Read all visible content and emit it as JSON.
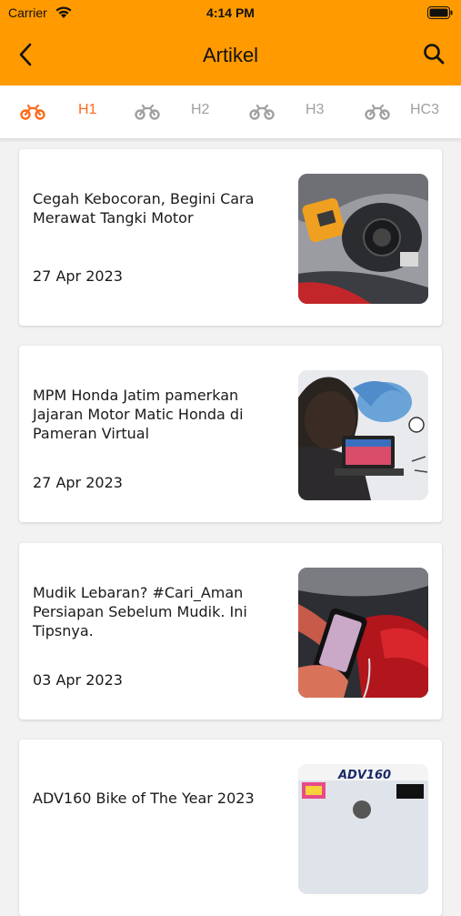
{
  "status_bar": {
    "carrier": "Carrier",
    "time": "4:14 PM"
  },
  "nav": {
    "title": "Artikel",
    "back_icon": "chevron-left-icon",
    "search_icon": "search-icon"
  },
  "tabs": [
    {
      "label": "H1",
      "active": true
    },
    {
      "label": "H2",
      "active": false
    },
    {
      "label": "H3",
      "active": false
    },
    {
      "label": "HC3",
      "active": false
    }
  ],
  "articles": [
    {
      "title": "Cegah Kebocoran, Begini Cara Merawat Tangki Motor",
      "date": "27 Apr 2023"
    },
    {
      "title": "MPM Honda Jatim pamerkan Jajaran Motor Matic Honda di Pameran Virtual",
      "date": "27 Apr 2023"
    },
    {
      "title": "Mudik Lebaran? #Cari_Aman Persiapan Sebelum Mudik. Ini Tipsnya.",
      "date": "03 Apr 2023"
    },
    {
      "title": "ADV160 Bike of The Year 2023",
      "date": "",
      "thumb_text": "ADV160"
    }
  ],
  "colors": {
    "header": "#ff9a00",
    "accent": "#ff6a1a",
    "inactive": "#a0a0a0"
  }
}
